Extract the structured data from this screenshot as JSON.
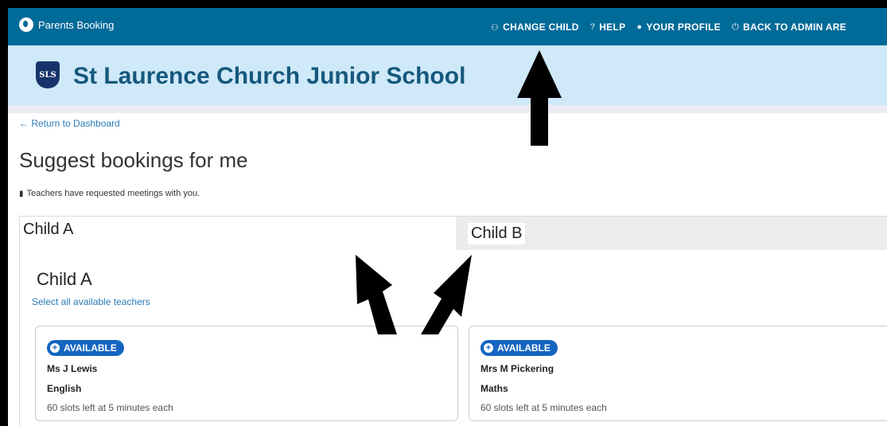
{
  "topbar": {
    "brand": "Parents Booking",
    "nav": [
      {
        "icon": "users-icon",
        "glyph": "⚇",
        "label": "CHANGE CHILD"
      },
      {
        "icon": "help-icon",
        "glyph": "?",
        "label": "HELP"
      },
      {
        "icon": "user-icon",
        "glyph": "●",
        "label": "YOUR PROFILE"
      },
      {
        "icon": "power-icon",
        "glyph": "⏻",
        "label": "BACK TO ADMIN ARE"
      }
    ]
  },
  "school": {
    "crest_text": "SLS",
    "name": "St Laurence Church Junior School"
  },
  "back_link": "← Return to Dashboard",
  "page_title": "Suggest bookings for me",
  "note": "Teachers have requested meetings with you.",
  "tabs": [
    "Child A",
    "Child B"
  ],
  "panel": {
    "heading": "Child A",
    "select_all": "Select all available teachers"
  },
  "cards": [
    {
      "badge": "AVAILABLE",
      "teacher": "Ms J Lewis",
      "subject": "English",
      "slots": "60 slots left at 5 minutes each"
    },
    {
      "badge": "AVAILABLE",
      "teacher": "Mrs M Pickering",
      "subject": "Maths",
      "slots": "60 slots left at 5 minutes each"
    }
  ],
  "colors": {
    "topbar": "#006a99",
    "header": "#cfe9f9",
    "badge": "#1565c0",
    "link": "#2a7bb8"
  }
}
